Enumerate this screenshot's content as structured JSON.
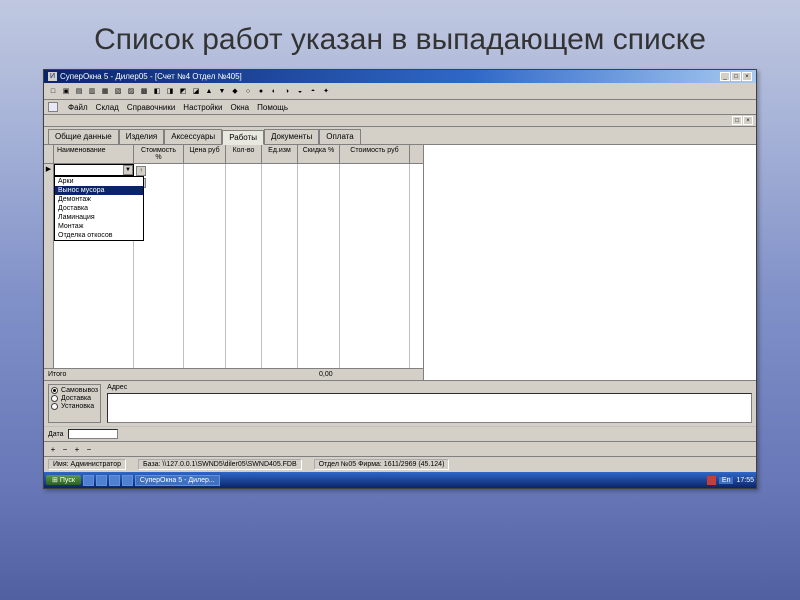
{
  "slide": {
    "title": "Список работ указан в выпадающем списке"
  },
  "window": {
    "title": "СуперОкна 5 - Дилер05 - [Счет №4 Отдел №405]",
    "controls": {
      "min": "_",
      "max": "□",
      "close": "×"
    }
  },
  "menu": {
    "items": [
      "Файл",
      "Склад",
      "Справочники",
      "Настройки",
      "Окна",
      "Помощь"
    ]
  },
  "inner_controls": {
    "close": "×",
    "max": "□"
  },
  "tabs": {
    "items": [
      "Общие данные",
      "Изделия",
      "Аксессуары",
      "Работы",
      "Документы",
      "Оплата"
    ],
    "active": 3
  },
  "grid": {
    "columns": [
      "Наименование",
      "Стоимость %",
      "Цена руб",
      "Кол-во",
      "Ед.изм",
      "Скидка %",
      "Стоимость руб"
    ],
    "row_marker": "▶",
    "dropdown": {
      "items": [
        "Арки",
        "Вынос мусора",
        "Демонтаж",
        "Доставка",
        "Ламинация",
        "Монтаж",
        "Отделка откосов"
      ],
      "selected_index": 1
    },
    "arrows": {
      "up": "↑",
      "down": "↓"
    },
    "footer": {
      "label": "Итого",
      "value": "0,00"
    }
  },
  "bottom": {
    "radios": [
      "Самовывоз",
      "Доставка",
      "Установка"
    ],
    "checked": 0,
    "address_label": "Адрес",
    "date_label": "Дата"
  },
  "mini_toolbar": [
    "+",
    "−",
    "+",
    "−"
  ],
  "status": {
    "user_label": "Имя: Администратор",
    "db_label": "База: \\\\127.0.0.1\\SWND5\\diler05\\SWND405.FDB",
    "dept_label": "Отдел №05 Фирма: 1611/2969 (45.124)"
  },
  "taskbar": {
    "start": "Пуск",
    "task": "СуперОкна 5 - Дилер...",
    "lang": "En",
    "time": "17:55"
  }
}
